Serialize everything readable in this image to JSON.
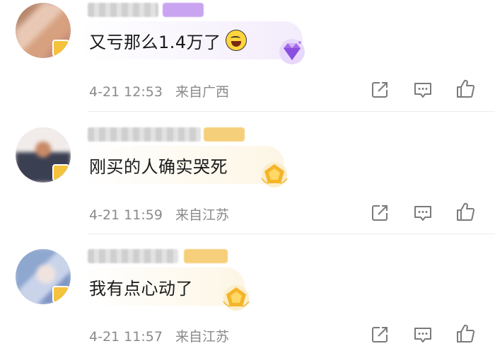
{
  "comments": [
    {
      "text": "又亏那么1.4万了",
      "has_emoji": true,
      "emoji_icon": "laugh-cry-emoji",
      "badge_icon": "purple-diamond-badge",
      "date": "4-21",
      "time": "12:53",
      "location": "来自广西"
    },
    {
      "text": "刚买的人确实哭死",
      "has_emoji": false,
      "badge_icon": "gold-pentagon-badge",
      "date": "4-21",
      "time": "11:59",
      "location": "来自江苏"
    },
    {
      "text": "我有点心动了",
      "has_emoji": false,
      "badge_icon": "gold-pentagon-badge",
      "date": "4-21",
      "time": "11:57",
      "location": "来自江苏"
    }
  ],
  "actions": [
    "share-icon",
    "reply-icon",
    "like-icon"
  ],
  "colors": {
    "meta_text": "#8a8a8a",
    "bubble_purple": "#f3ecfb",
    "bubble_gold": "#fdf6e6",
    "vip_purple": "#c9a4f1",
    "vip_gold": "#f6cf7b",
    "icon": "#7a7a7a"
  }
}
